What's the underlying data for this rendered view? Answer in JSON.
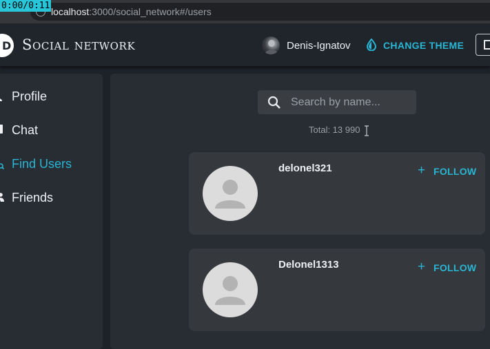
{
  "browser": {
    "timer": "0:00/0:11",
    "url_host": "localhost",
    "url_path": ":3000/social_network#/users"
  },
  "header": {
    "logo_letter": "D",
    "brand": "Social network",
    "user_name": "Denis-Ignatov",
    "change_theme": "CHANGE THEME",
    "accent_color": "#29b6d4"
  },
  "sidebar": {
    "items": [
      {
        "label": "Profile",
        "icon": "person-icon"
      },
      {
        "label": "Chat",
        "icon": "chat-icon"
      },
      {
        "label": "Find Users",
        "icon": "find-users-icon",
        "active": true
      },
      {
        "label": "Friends",
        "icon": "friends-icon"
      }
    ]
  },
  "search": {
    "placeholder": "Search by name...",
    "value": ""
  },
  "users": {
    "total": "Total: 13 990",
    "follow_label": "FOLLOW",
    "list": [
      {
        "name": "delonel321"
      },
      {
        "name": "Delonel1313"
      }
    ]
  }
}
